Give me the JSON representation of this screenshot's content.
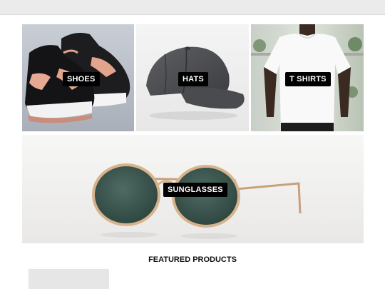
{
  "categories": [
    {
      "id": "shoes",
      "label": "SHOES"
    },
    {
      "id": "hats",
      "label": "HATS"
    },
    {
      "id": "tshirts",
      "label": "T SHIRTS"
    },
    {
      "id": "sunglasses",
      "label": "SUNGLASSES"
    }
  ],
  "featured": {
    "title": "FEATURED PRODUCTS"
  }
}
